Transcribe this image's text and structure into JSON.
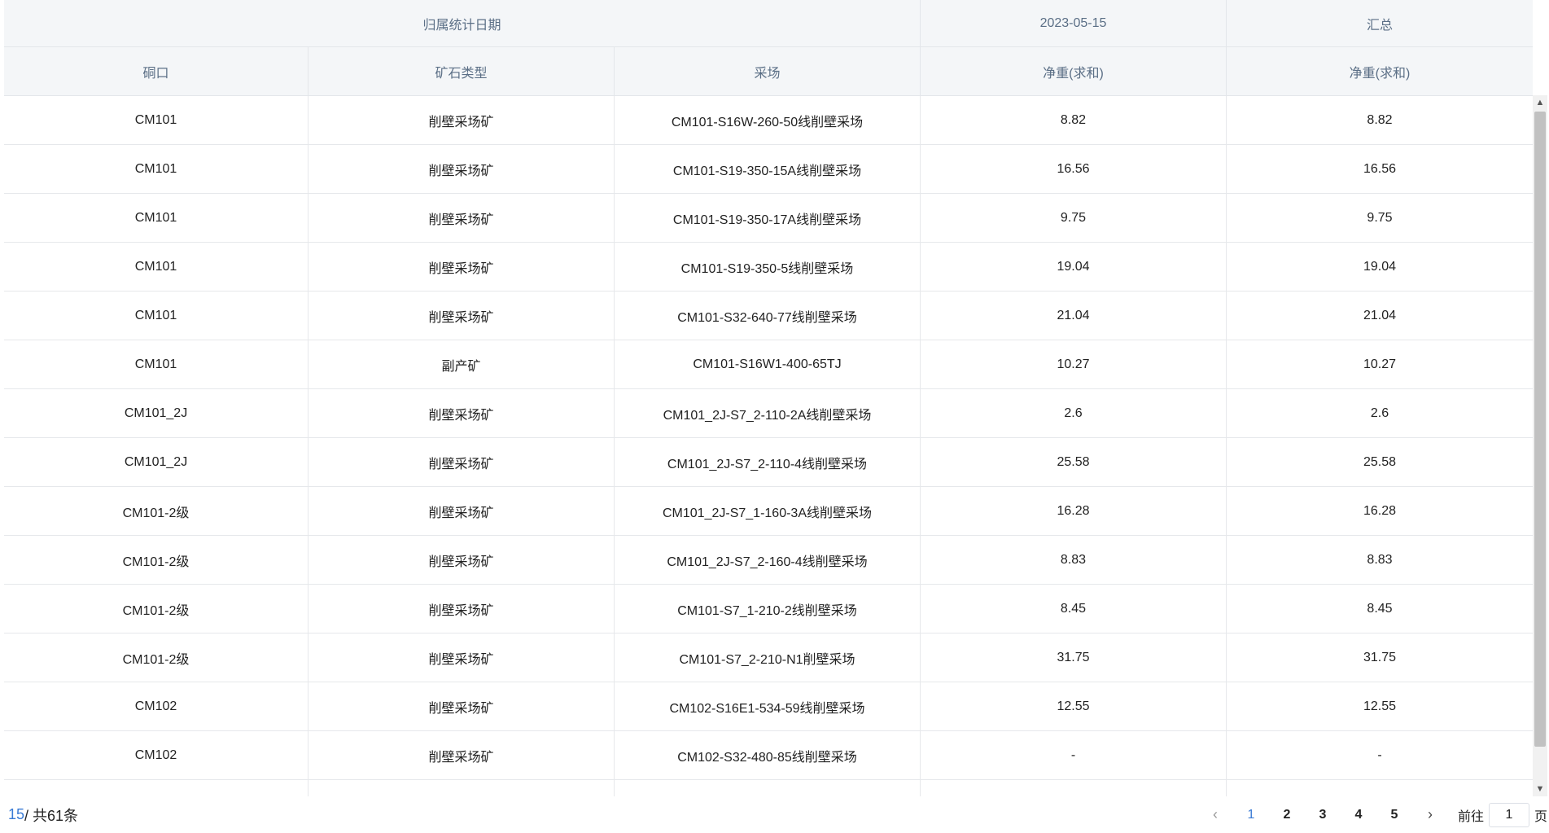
{
  "header": {
    "group_label": "归属统计日期",
    "date_label": "2023-05-15",
    "summary_label": "汇总",
    "columns": [
      "硐口",
      "矿石类型",
      "采场",
      "净重(求和)",
      "净重(求和)"
    ]
  },
  "rows": [
    [
      "CM101",
      "削壁采场矿",
      "CM101-S16W-260-50线削壁采场",
      "8.82",
      "8.82"
    ],
    [
      "CM101",
      "削壁采场矿",
      "CM101-S19-350-15A线削壁采场",
      "16.56",
      "16.56"
    ],
    [
      "CM101",
      "削壁采场矿",
      "CM101-S19-350-17A线削壁采场",
      "9.75",
      "9.75"
    ],
    [
      "CM101",
      "削壁采场矿",
      "CM101-S19-350-5线削壁采场",
      "19.04",
      "19.04"
    ],
    [
      "CM101",
      "削壁采场矿",
      "CM101-S32-640-77线削壁采场",
      "21.04",
      "21.04"
    ],
    [
      "CM101",
      "副产矿",
      "CM101-S16W1-400-65TJ",
      "10.27",
      "10.27"
    ],
    [
      "CM101_2J",
      "削壁采场矿",
      "CM101_2J-S7_2-110-2A线削壁采场",
      "2.6",
      "2.6"
    ],
    [
      "CM101_2J",
      "削壁采场矿",
      "CM101_2J-S7_2-110-4线削壁采场",
      "25.58",
      "25.58"
    ],
    [
      "CM101-2级",
      "削壁采场矿",
      "CM101_2J-S7_1-160-3A线削壁采场",
      "16.28",
      "16.28"
    ],
    [
      "CM101-2级",
      "削壁采场矿",
      "CM101_2J-S7_2-160-4线削壁采场",
      "8.83",
      "8.83"
    ],
    [
      "CM101-2级",
      "削壁采场矿",
      "CM101-S7_1-210-2线削壁采场",
      "8.45",
      "8.45"
    ],
    [
      "CM101-2级",
      "削壁采场矿",
      "CM101-S7_2-210-N1削壁采场",
      "31.75",
      "31.75"
    ],
    [
      "CM102",
      "削壁采场矿",
      "CM102-S16E1-534-59线削壁采场",
      "12.55",
      "12.55"
    ],
    [
      "CM102",
      "削壁采场矿",
      "CM102-S32-480-85线削壁采场",
      "-",
      "-"
    ]
  ],
  "footer": {
    "current": "15",
    "total_text": "/ 共61条",
    "pages": [
      "1",
      "2",
      "3",
      "4",
      "5"
    ],
    "prev_icon": "chevron-left-icon",
    "next_icon": "chevron-right-icon",
    "goto_label": "前往",
    "goto_value": "1",
    "page_suffix": "页"
  },
  "colors": {
    "accent": "#3a7bd5",
    "header_bg": "#f4f6f8",
    "header_text": "#5b6f86"
  }
}
